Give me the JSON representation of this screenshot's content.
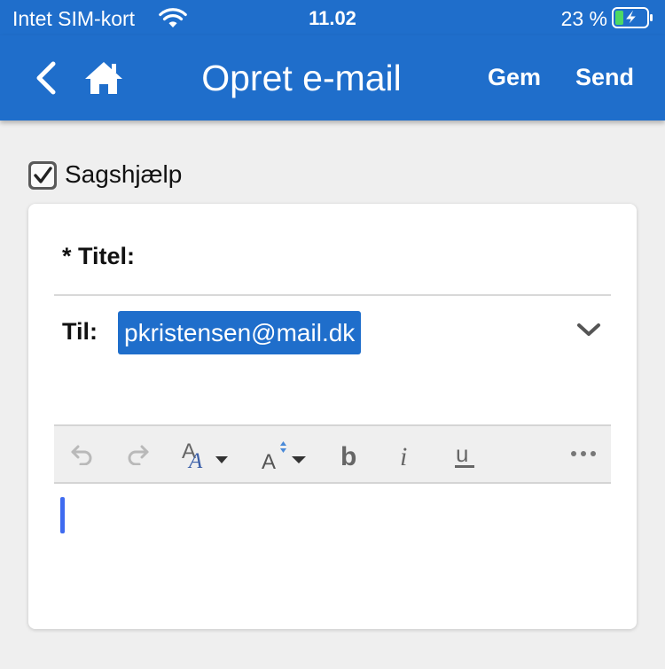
{
  "status_bar": {
    "carrier": "Intet SIM-kort",
    "time": "11.02",
    "battery_percent": "23 %",
    "icons": [
      "wifi-icon",
      "battery-charging-icon"
    ],
    "battery_level": 0.23
  },
  "nav": {
    "title": "Opret e-mail",
    "save_label": "Gem",
    "send_label": "Send",
    "icons": [
      "back-chevron-icon",
      "home-icon"
    ]
  },
  "case_help": {
    "label": "Sagshjælp",
    "checked": true
  },
  "form": {
    "title_label": "* Titel:",
    "title_value": "",
    "to_label": "Til:",
    "recipient": "pkristensen@mail.dk"
  },
  "toolbar": {
    "buttons": [
      "undo-icon",
      "redo-icon",
      "font-style-icon",
      "font-size-icon",
      "bold-icon",
      "italic-icon",
      "underline-icon",
      "more-icon"
    ]
  },
  "colors": {
    "primary": "#1f6ecb",
    "background": "#efefef",
    "card": "#ffffff",
    "caret": "#3f6bf0",
    "battery_green": "#4cd964"
  }
}
